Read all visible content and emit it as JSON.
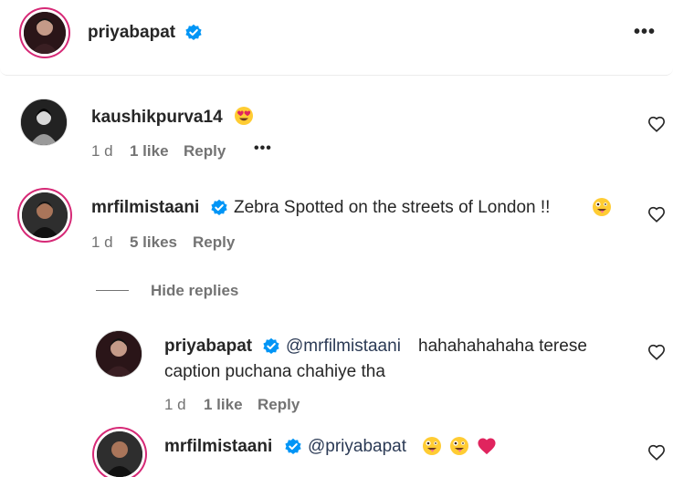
{
  "post": {
    "author": "priyabapat",
    "more_label": "•••"
  },
  "comments": [
    {
      "username": "kaushikpurva14",
      "text": "",
      "time": "1 d",
      "likes": "1 like",
      "reply_label": "Reply",
      "more_label": "•••"
    },
    {
      "username": "mrfilmistaani",
      "text": "Zebra Spotted on the streets of London !!",
      "time": "1 d",
      "likes": "5 likes",
      "reply_label": "Reply",
      "hide_replies_label": "Hide replies"
    }
  ],
  "replies": [
    {
      "username": "priyabapat",
      "mention": "@mrfilmistaani",
      "text_line1": "hahahahahaha terese",
      "text_line2": "caption puchana chahiye tha",
      "time": "1 d",
      "likes": "1 like",
      "reply_label": "Reply"
    },
    {
      "username": "mrfilmistaani",
      "mention": "@priyabapat"
    }
  ],
  "colors": {
    "verified_badge": "#0095f6",
    "story_ring": "#d62976",
    "meta_text": "#737373",
    "heart_emoji": "#e0245e"
  }
}
